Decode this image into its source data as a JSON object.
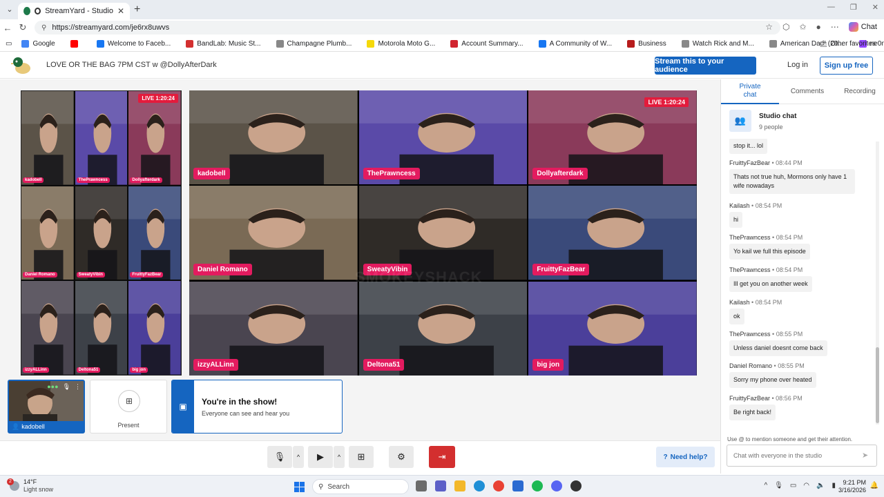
{
  "browser": {
    "tab_title": "StreamYard - Studio",
    "url": "https://streamyard.com/je6rx8uwvs",
    "chat_label": "Chat",
    "bookmarks": [
      {
        "label": "Google",
        "color": "#4285f4"
      },
      {
        "label": "",
        "color": "#ff0000"
      },
      {
        "label": "Welcome to Faceb...",
        "color": "#1877f2"
      },
      {
        "label": "BandLab: Music St...",
        "color": "#d32f2f"
      },
      {
        "label": "Champagne Plumb...",
        "color": "#888888"
      },
      {
        "label": "Motorola Moto G...",
        "color": "#f5d90a"
      },
      {
        "label": "Account Summary...",
        "color": "#d1242f"
      },
      {
        "label": "A Community of W...",
        "color": "#1877f2"
      },
      {
        "label": "Business",
        "color": "#b71c1c"
      },
      {
        "label": "Watch Rick and M...",
        "color": "#888888"
      },
      {
        "label": "American Dad! (20...",
        "color": "#888888"
      },
      {
        "label": "ne0nchill - Twitch x...",
        "color": "#9146ff"
      }
    ],
    "other_favorites": "Other favorites"
  },
  "header": {
    "broadcast_title": "LOVE OR THE BAG 7PM CST w @DollyAfterDark",
    "stream_button": "Stream this to your audience",
    "login": "Log in",
    "signup": "Sign up free"
  },
  "stage": {
    "live_badge": "LIVE 1:20:24",
    "watermark": "SMOKEYSHACK",
    "participants": [
      {
        "name": "kadobell",
        "color": "#5b5348"
      },
      {
        "name": "ThePrawncess",
        "color": "#5a4aa8"
      },
      {
        "name": "Dollyafterdark",
        "color": "#8a3a5a"
      },
      {
        "name": "Daniel Romano",
        "color": "#7a6a55"
      },
      {
        "name": "SweatyVibin",
        "color": "#2f2b27"
      },
      {
        "name": "FruittyFazBear",
        "color": "#3a4a7a"
      },
      {
        "name": "izzyALLinn",
        "color": "#4a4550"
      },
      {
        "name": "Deltona51",
        "color": "#3d4148"
      },
      {
        "name": "big jon",
        "color": "#4b3f9a"
      }
    ],
    "mini_labels": [
      "kadobell",
      "ThePrawncess",
      "Dollyafterdark",
      "Daniel Romano",
      "SweatyVibin",
      "FruittyFazBear",
      "izzyALLinn",
      "Deltona51",
      "big jon"
    ]
  },
  "below_stage": {
    "self_name": "kadobell",
    "present_label": "Present",
    "in_show_title": "You're in the show!",
    "in_show_subtitle": "Everyone can see and hear you"
  },
  "controls": {
    "help": "Need help?"
  },
  "chat": {
    "tabs": [
      "Private chat",
      "Comments",
      "Recording"
    ],
    "active_tab": "Private chat",
    "studio_title": "Studio chat",
    "people_count": "9 people",
    "messages": [
      {
        "author": "",
        "time": "",
        "text": "stop it... lol"
      },
      {
        "author": "FruittyFazBear",
        "time": "08:44 PM",
        "text": "Thats not true huh, Mormons only have 1 wife nowadays"
      },
      {
        "author": "Kailash",
        "time": "08:54 PM",
        "text": "hi"
      },
      {
        "author": "ThePrawncess",
        "time": "08:54 PM",
        "text": "Yo kail we full this episode"
      },
      {
        "author": "ThePrawncess",
        "time": "08:54 PM",
        "text": "Ill get you on another week"
      },
      {
        "author": "Kailash",
        "time": "08:54 PM",
        "text": "ok"
      },
      {
        "author": "ThePrawncess",
        "time": "08:55 PM",
        "text": "Unless daniel doesnt come back"
      },
      {
        "author": "Daniel Romano",
        "time": "08:55 PM",
        "text": "Sorry my phone over heated"
      },
      {
        "author": "FruittyFazBear",
        "time": "08:56 PM",
        "text": "Be right back!"
      }
    ],
    "hint": "Use @ to mention someone and get their attention.",
    "input_placeholder": "Chat with everyone in the studio"
  },
  "taskbar": {
    "weather_badge": "2",
    "temp": "14°F",
    "condition": "Light snow",
    "search": "Search",
    "time": "9:21 PM",
    "date": "3/16/2026"
  }
}
